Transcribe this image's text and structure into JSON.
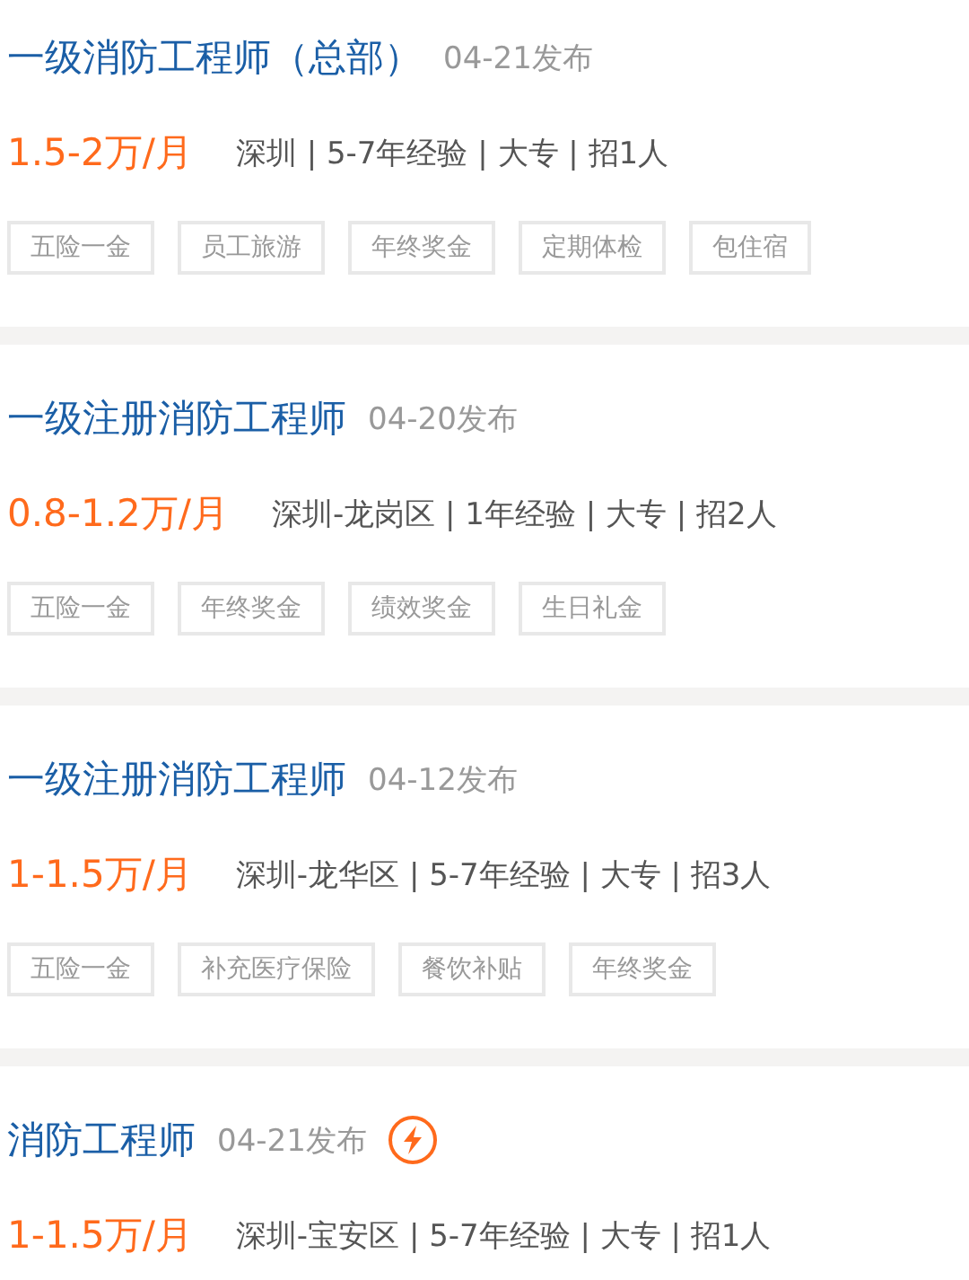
{
  "jobs": [
    {
      "title": "一级消防工程师（总部）",
      "date": "04-21发布",
      "urgent": false,
      "salary": "1.5-2万/月",
      "info": "深圳 | 5-7年经验 | 大专 | 招1人",
      "tags": [
        "五险一金",
        "员工旅游",
        "年终奖金",
        "定期体检",
        "包住宿"
      ]
    },
    {
      "title": "一级注册消防工程师",
      "date": "04-20发布",
      "urgent": false,
      "salary": "0.8-1.2万/月",
      "info": "深圳-龙岗区 | 1年经验 | 大专 | 招2人",
      "tags": [
        "五险一金",
        "年终奖金",
        "绩效奖金",
        "生日礼金"
      ]
    },
    {
      "title": "一级注册消防工程师",
      "date": "04-12发布",
      "urgent": false,
      "salary": "1-1.5万/月",
      "info": "深圳-龙华区 | 5-7年经验 | 大专 | 招3人",
      "tags": [
        "五险一金",
        "补充医疗保险",
        "餐饮补贴",
        "年终奖金"
      ]
    },
    {
      "title": "消防工程师",
      "date": "04-21发布",
      "urgent": true,
      "salary": "1-1.5万/月",
      "info": "深圳-宝安区 | 5-7年经验 | 大专 | 招1人"
    }
  ]
}
